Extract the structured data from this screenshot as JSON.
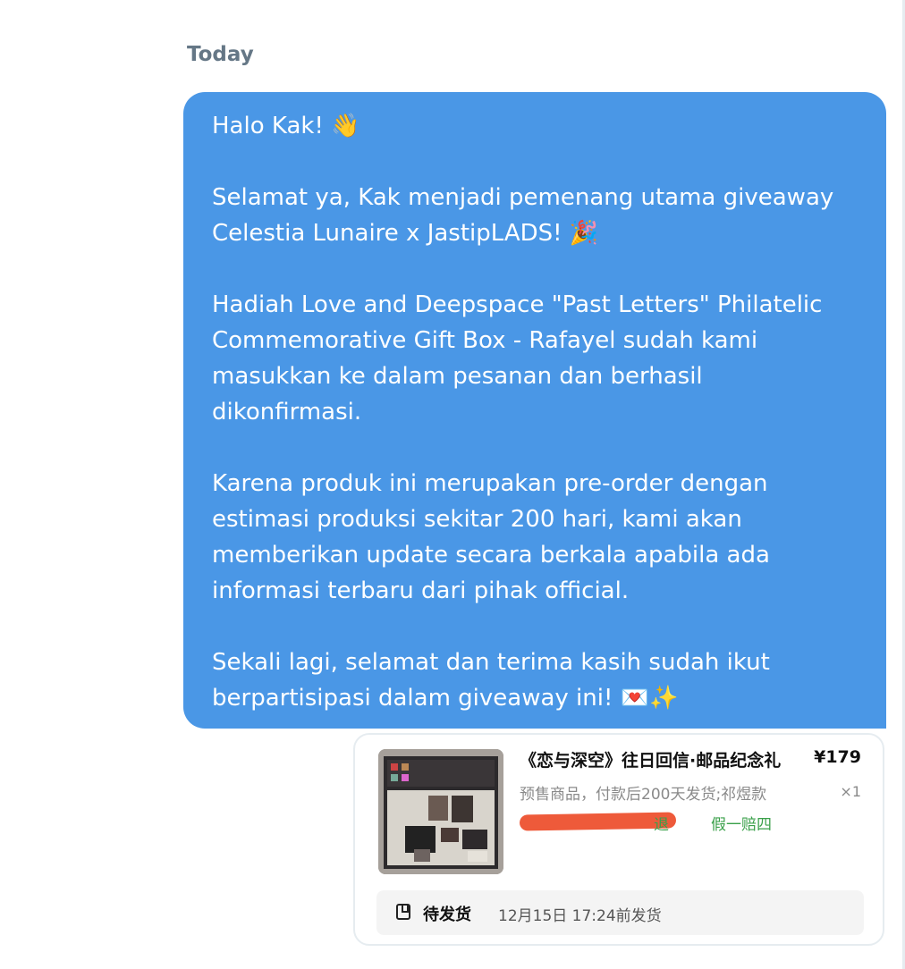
{
  "conversation": {
    "day_label": "Today",
    "message": {
      "greeting": "Halo Kak! 👋",
      "congrats": "Selamat ya, Kak menjadi pemenang utama giveaway Celestia Lunaire x JastipLADS! 🎉",
      "prize": "Hadiah Love and Deepspace \"Past Letters\" Philatelic Commemorative Gift Box - Rafayel  sudah kami masukkan ke dalam pesanan dan berhasil dikonfirmasi.",
      "preorder": "Karena produk ini merupakan pre-order dengan estimasi produksi sekitar 200 hari, kami akan memberikan update secara berkala apabila ada informasi terbaru dari pihak official.",
      "closing": "Sekali lagi, selamat dan terima kasih sudah ikut berpartisipasi dalam giveaway ini! 💌✨"
    },
    "bubble_color": "#4a97e6"
  },
  "order_card": {
    "product_title": "《恋与深空》往日回信·邮品纪念礼",
    "price": "¥179",
    "description": "预售商品，付款后200天发货;祁煜款",
    "quantity": "×1",
    "tag_partial": "退",
    "tag_guarantee": "假一赔四",
    "status_label": "待发货",
    "status_time": "12月15日 17:24前发货",
    "tag_color": "#3aa04a"
  }
}
